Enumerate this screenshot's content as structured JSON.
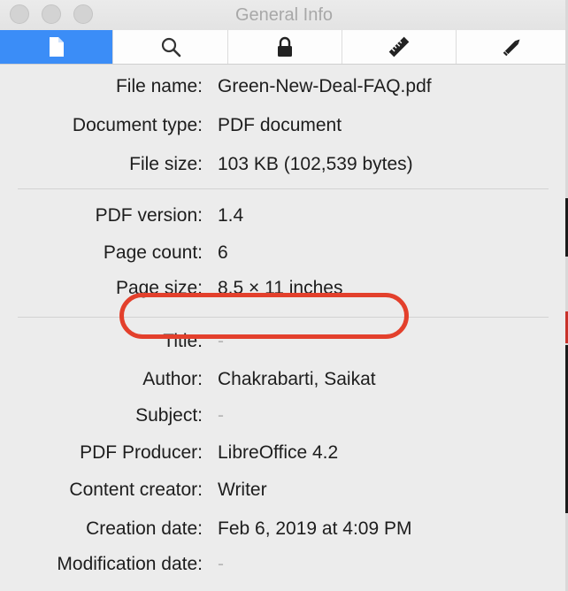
{
  "window": {
    "title": "General Info"
  },
  "tabs": [
    {
      "name": "general",
      "icon": "document-icon",
      "active": true
    },
    {
      "name": "search",
      "icon": "magnifier-icon",
      "active": false
    },
    {
      "name": "security",
      "icon": "lock-icon",
      "active": false
    },
    {
      "name": "measure",
      "icon": "ruler-icon",
      "active": false
    },
    {
      "name": "annotate",
      "icon": "pencil-icon",
      "active": false
    }
  ],
  "fields": {
    "file_name": {
      "label": "File name:",
      "value": "Green-New-Deal-FAQ.pdf"
    },
    "document_type": {
      "label": "Document type:",
      "value": "PDF document"
    },
    "file_size": {
      "label": "File size:",
      "value": "103 KB (102,539 bytes)"
    },
    "pdf_version": {
      "label": "PDF version:",
      "value": "1.4"
    },
    "page_count": {
      "label": "Page count:",
      "value": "6"
    },
    "page_size": {
      "label": "Page size:",
      "value": "8.5 × 11 inches"
    },
    "title": {
      "label": "Title:",
      "value": "-"
    },
    "author": {
      "label": "Author:",
      "value": "Chakrabarti, Saikat"
    },
    "subject": {
      "label": "Subject:",
      "value": "-"
    },
    "pdf_producer": {
      "label": "PDF Producer:",
      "value": "LibreOffice 4.2"
    },
    "content_creator": {
      "label": "Content creator:",
      "value": "Writer"
    },
    "creation_date": {
      "label": "Creation date:",
      "value": "Feb 6, 2019 at 4:09 PM"
    },
    "modification_date": {
      "label": "Modification date:",
      "value": "-"
    }
  },
  "colors": {
    "active_tab": "#3b8df7",
    "highlight_ring": "#e3402c"
  }
}
